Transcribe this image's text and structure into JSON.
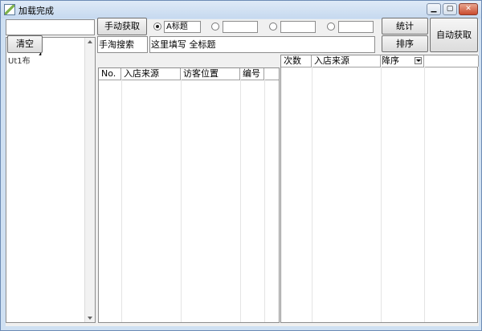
{
  "window": {
    "title": "加载完成"
  },
  "controls": {
    "clear_button": "清空",
    "manual_fetch_button": "手动获取",
    "stats_button": "统计",
    "sort_button": "排序",
    "auto_fetch_button": "自动获取",
    "left_list_partial": "】",
    "left_list_partial2": "Ut1布"
  },
  "radios": [
    {
      "label": "A标题",
      "selected": true
    },
    {
      "label": "",
      "selected": false
    },
    {
      "label": "",
      "selected": false
    },
    {
      "label": "",
      "selected": false
    }
  ],
  "inputs": {
    "source_field": "手淘搜索",
    "title_field": "这里填写 全标题"
  },
  "left_table": {
    "columns": [
      "No.",
      "入店来源",
      "访客位置",
      "编号"
    ]
  },
  "right_table": {
    "columns": [
      "次数",
      "入店来源"
    ],
    "sort_select": "降序"
  }
}
